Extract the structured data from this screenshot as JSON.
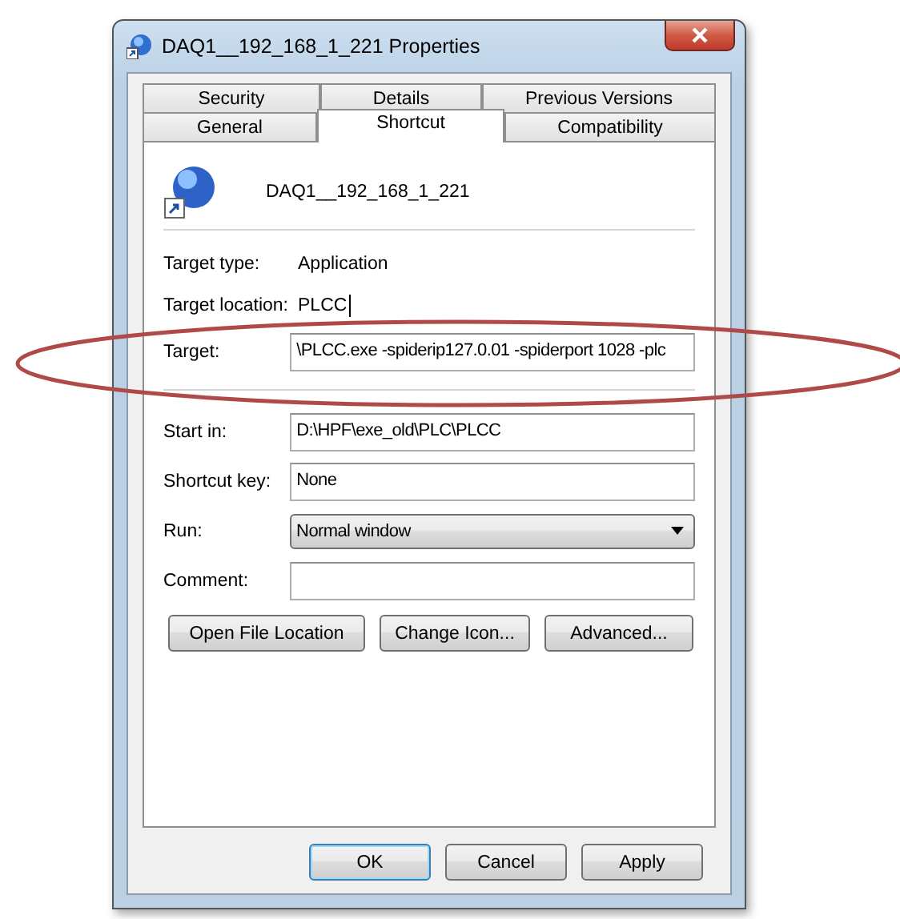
{
  "window": {
    "title": "DAQ1__192_168_1_221 Properties"
  },
  "tab_rows": [
    {
      "tabs": [
        {
          "label": "Security",
          "selected": false
        },
        {
          "label": "Details",
          "selected": false
        },
        {
          "label": "Previous Versions",
          "selected": false
        }
      ]
    },
    {
      "tabs": [
        {
          "label": "General",
          "selected": false
        },
        {
          "label": "Shortcut",
          "selected": true
        },
        {
          "label": "Compatibility",
          "selected": false
        }
      ]
    }
  ],
  "shortcut": {
    "name": "DAQ1__192_168_1_221"
  },
  "rows_top": [
    {
      "kind": "info",
      "label": "Target type:",
      "value": "Application"
    },
    {
      "kind": "info",
      "label": "Target location:",
      "value": "PLCC",
      "cursor": true
    },
    {
      "kind": "field",
      "label": "Target:",
      "value": "\\PLCC.exe -spiderip127.0.01 -spiderport 1028 -plc"
    }
  ],
  "rows_bottom": [
    {
      "kind": "field",
      "label": "Start in:",
      "value": "D:\\HPF\\exe_old\\PLC\\PLCC"
    },
    {
      "kind": "field",
      "label": "Shortcut key:",
      "value": "None"
    },
    {
      "kind": "dropdown",
      "label": "Run:",
      "value": "Normal window"
    },
    {
      "kind": "field",
      "label": "Comment:"
    }
  ],
  "panel_buttons": [
    "Open File Location",
    "Change Icon...",
    "Advanced..."
  ],
  "dialog_buttons": [
    {
      "label": "OK",
      "default": true
    },
    {
      "label": "Cancel",
      "default": false
    },
    {
      "label": "Apply",
      "default": false
    }
  ],
  "annotation": {
    "kind": "ellipse"
  }
}
